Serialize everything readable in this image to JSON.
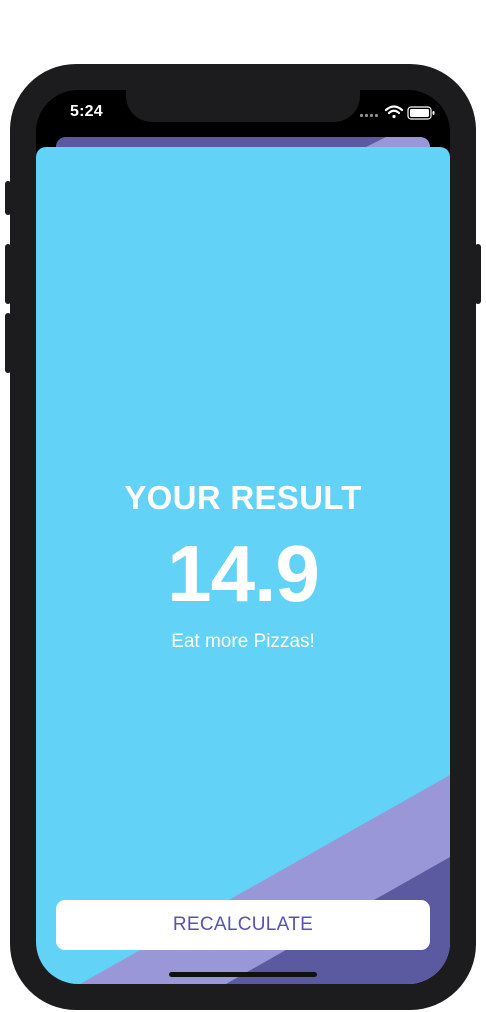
{
  "status_bar": {
    "time": "5:24",
    "icons": [
      "signal-icon",
      "wifi-icon",
      "battery-icon"
    ]
  },
  "result": {
    "title": "YOUR RESULT",
    "value": "14.9",
    "advice": "Eat more Pizzas!"
  },
  "actions": {
    "recalculate_label": "RECALCULATE"
  },
  "colors": {
    "background": "#63d2f7",
    "stripe_light": "#9a97d8",
    "stripe_dark": "#5b5aa0",
    "button_text": "#5852b8"
  }
}
